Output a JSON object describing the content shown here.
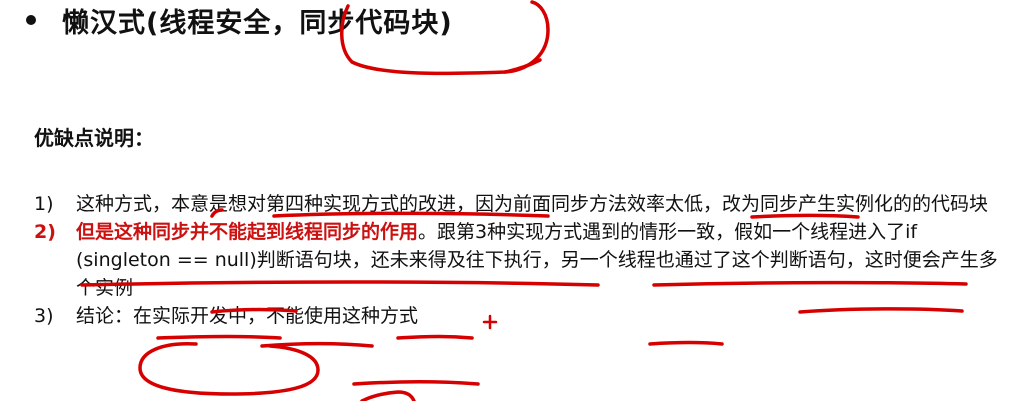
{
  "heading": {
    "bullet": "•",
    "text": "懒汉式(线程安全，同步代码块)"
  },
  "section": {
    "title": "优缺点说明："
  },
  "items": [
    {
      "num": "1)",
      "text": "这种方式，本意是想对第四种实现方式的改进，因为前面同步方法效率太低，改为同步产生实例化的的代码块"
    },
    {
      "num": "2)",
      "red_text": "但是这种同步并不能起到线程同步的作用",
      "text": "。跟第3种实现方式遇到的情形一致，假如一个线程进入了if (singleton == null)判断语句块，还未来得及往下执行，另一个线程也通过了这个判断语句，这时便会产生多个实例"
    },
    {
      "num": "3)",
      "text": "结论：在实际开发中，不能使用这种方式"
    }
  ],
  "colors": {
    "text": "#111111",
    "emphasis_red": "#cc1111",
    "annotation_red": "#d60000",
    "background": "#ffffff"
  }
}
